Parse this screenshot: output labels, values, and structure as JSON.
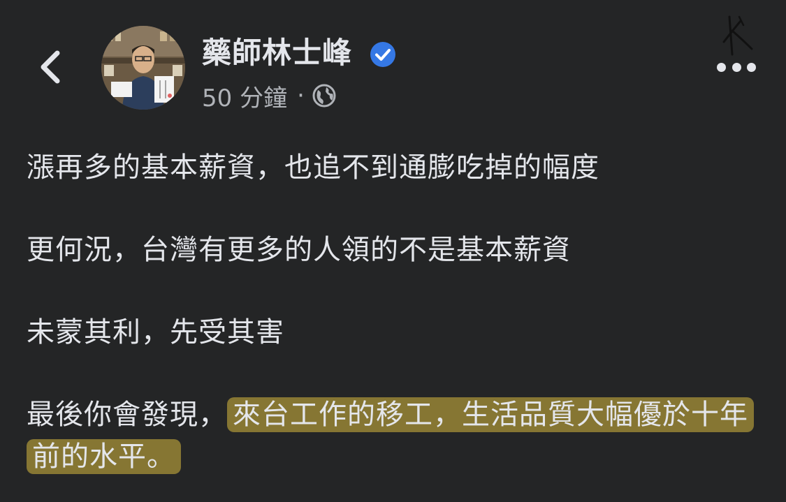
{
  "header": {
    "author_name": "藥師林士峰",
    "time_text": "50 分鐘",
    "separator": "·",
    "privacy_icon": "globe-icon",
    "verified_icon": "verified-badge-icon",
    "back_icon": "chevron-left-icon",
    "more_icon": "more-options-icon",
    "accent_color": "#3578e5"
  },
  "post": {
    "paragraphs": [
      "漲再多的基本薪資，也追不到通膨吃掉的幅度",
      "更何況，台灣有更多的人領的不是基本薪資",
      "未蒙其利，先受其害"
    ],
    "last_paragraph_plain": "最後你會發現，",
    "last_paragraph_highlighted": "來台工作的移工，生活品質大幅優於十年前的水平。",
    "highlight_color": "#c4a83c"
  }
}
